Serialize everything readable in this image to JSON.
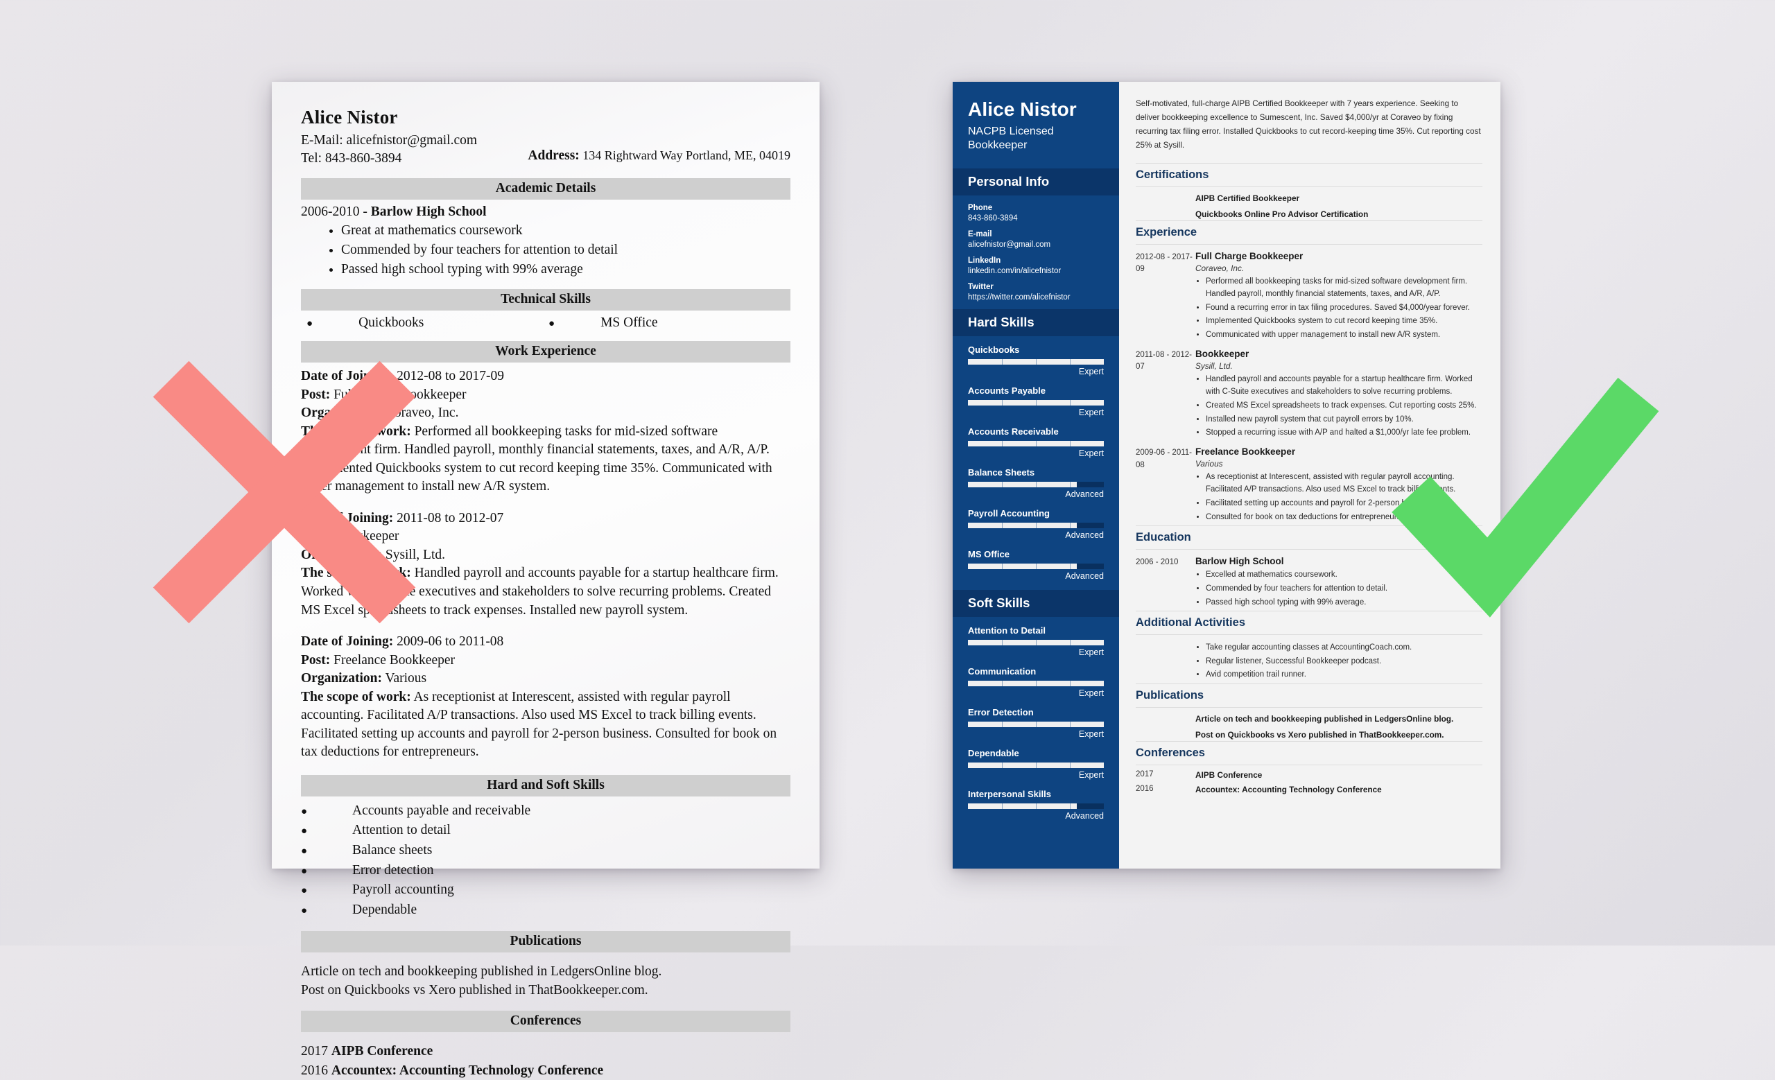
{
  "bad_resume": {
    "name": "Alice Nistor",
    "email_line": "E-Mail: alicefnistor@gmail.com",
    "tel_line": "Tel: 843-860-3894",
    "address_label": "Address:",
    "address_value": "134 Rightward Way Portland, ME, 04019",
    "sections": {
      "academic": {
        "heading": "Academic Details",
        "school_line_years": "2006-2010 - ",
        "school_line_name": "Barlow High School",
        "bullets": [
          "Great at mathematics coursework",
          "Commended by four teachers for attention to detail",
          "Passed high school typing with 99% average"
        ]
      },
      "technical": {
        "heading": "Technical Skills",
        "items": [
          "Quickbooks",
          "MS Office"
        ]
      },
      "work": {
        "heading": "Work Experience",
        "labels": {
          "date": "Date of Joining:",
          "post": "Post:",
          "org": "Organization:",
          "scope": "The scope of work:"
        },
        "jobs": [
          {
            "dates": "2012-08 to 2017-09",
            "post": "Full Charge Bookkeeper",
            "org": "Coraveo, Inc.",
            "scope": "Performed all bookkeeping tasks for mid-sized software development firm. Handled payroll, monthly financial statements, taxes, and A/R, A/P. Implemented Quickbooks system to cut record keeping time 35%. Communicated with upper management to install new A/R system."
          },
          {
            "dates": "2011-08 to 2012-07",
            "post": "Bookkeeper",
            "org": "Sysill, Ltd.",
            "scope": "Handled payroll and accounts payable for a startup healthcare firm. Worked with C-Suite executives and stakeholders to solve recurring problems. Created MS Excel spreadsheets to track expenses. Installed new payroll system."
          },
          {
            "dates": "2009-06 to 2011-08",
            "post": "Freelance Bookkeeper",
            "org": "Various",
            "scope": "As receptionist at Interescent, assisted with regular payroll accounting. Facilitated A/P transactions. Also used MS Excel to track billing events. Facilitated setting up accounts and payroll for 2-person business. Consulted for book on tax deductions for entrepreneurs."
          }
        ]
      },
      "skills": {
        "heading": "Hard and Soft Skills",
        "items": [
          "Accounts payable and receivable",
          "Attention to detail",
          "Balance sheets",
          "Error detection",
          "Payroll accounting",
          "Dependable"
        ]
      },
      "publications": {
        "heading": "Publications",
        "lines": [
          "Article on tech and bookkeeping published in LedgersOnline blog.",
          "Post on Quickbooks vs Xero published in ThatBookkeeper.com."
        ]
      },
      "conferences": {
        "heading": "Conferences",
        "items": [
          {
            "year": "2017 ",
            "name": "AIPB Conference"
          },
          {
            "year": "2016 ",
            "name": "Accountex: Accounting Technology Conference"
          }
        ]
      }
    }
  },
  "good_resume": {
    "sidebar": {
      "name": "Alice Nistor",
      "title": "NACPB Licensed Bookkeeper",
      "personal_info": {
        "heading": "Personal Info",
        "fields": [
          {
            "label": "Phone",
            "value": "843-860-3894"
          },
          {
            "label": "E-mail",
            "value": "alicefnistor@gmail.com"
          },
          {
            "label": "LinkedIn",
            "value": "linkedin.com/in/alicefnistor"
          },
          {
            "label": "Twitter",
            "value": "https://twitter.com/alicefnistor"
          }
        ]
      },
      "hard_skills": {
        "heading": "Hard Skills",
        "items": [
          {
            "name": "Quickbooks",
            "level": "Expert",
            "pct": 100
          },
          {
            "name": "Accounts Payable",
            "level": "Expert",
            "pct": 100
          },
          {
            "name": "Accounts Receivable",
            "level": "Expert",
            "pct": 100
          },
          {
            "name": "Balance Sheets",
            "level": "Advanced",
            "pct": 80
          },
          {
            "name": "Payroll Accounting",
            "level": "Advanced",
            "pct": 80
          },
          {
            "name": "MS Office",
            "level": "Advanced",
            "pct": 80
          }
        ]
      },
      "soft_skills": {
        "heading": "Soft Skills",
        "items": [
          {
            "name": "Attention to Detail",
            "level": "Expert",
            "pct": 100
          },
          {
            "name": "Communication",
            "level": "Expert",
            "pct": 100
          },
          {
            "name": "Error Detection",
            "level": "Expert",
            "pct": 100
          },
          {
            "name": "Dependable",
            "level": "Expert",
            "pct": 100
          },
          {
            "name": "Interpersonal Skills",
            "level": "Advanced",
            "pct": 80
          }
        ]
      }
    },
    "main": {
      "summary": "Self-motivated, full-charge AIPB Certified Bookkeeper with 7 years experience. Seeking to deliver bookkeeping excellence to Sumescent, Inc. Saved $4,000/yr at Coraveo by fixing recurring tax filing error. Installed Quickbooks to cut record-keeping time 35%. Cut reporting cost 25% at Sysill.",
      "certifications": {
        "heading": "Certifications",
        "items": [
          "AIPB Certified Bookkeeper",
          "Quickbooks Online Pro Advisor Certification"
        ]
      },
      "experience": {
        "heading": "Experience",
        "jobs": [
          {
            "dates": "2012-08 - 2017-09",
            "title": "Full Charge Bookkeeper",
            "org": "Coraveo, Inc.",
            "bullets": [
              "Performed all bookkeeping tasks for mid-sized software development firm. Handled payroll, monthly financial statements, taxes, and A/R, A/P.",
              "Found a recurring error in tax filing procedures. Saved $4,000/year forever.",
              "Implemented Quickbooks system to cut record keeping time 35%.",
              "Communicated with upper management to install new A/R system."
            ]
          },
          {
            "dates": "2011-08 - 2012-07",
            "title": "Bookkeeper",
            "org": "Sysill, Ltd.",
            "bullets": [
              "Handled payroll and accounts payable for a startup healthcare firm. Worked with C-Suite executives and stakeholders to solve recurring problems.",
              "Created MS Excel spreadsheets to track expenses. Cut reporting costs 25%.",
              "Installed new payroll system that cut payroll errors by 10%.",
              "Stopped a recurring issue with A/P and halted a $1,000/yr late fee problem."
            ]
          },
          {
            "dates": "2009-06 - 2011-08",
            "title": "Freelance Bookkeeper",
            "org": "Various",
            "bullets": [
              "As receptionist at Interescent, assisted with regular payroll accounting. Facilitated A/P transactions. Also used MS Excel to track billing events.",
              "Facilitated setting up accounts and payroll for 2-person business.",
              "Consulted for book on tax deductions for entrepreneurs."
            ]
          }
        ]
      },
      "education": {
        "heading": "Education",
        "items": [
          {
            "dates": "2006 - 2010",
            "title": "Barlow High School",
            "bullets": [
              "Excelled at mathematics coursework.",
              "Commended by four teachers for attention to detail.",
              "Passed high school typing with 99% average."
            ]
          }
        ]
      },
      "additional": {
        "heading": "Additional Activities",
        "bullets": [
          "Take regular accounting classes at AccountingCoach.com.",
          "Regular listener, Successful Bookkeeper podcast.",
          "Avid competition trail runner."
        ]
      },
      "publications": {
        "heading": "Publications",
        "items": [
          "Article on tech and bookkeeping published in LedgersOnline blog.",
          "Post on Quickbooks vs Xero published in ThatBookkeeper.com."
        ]
      },
      "conferences": {
        "heading": "Conferences",
        "items": [
          {
            "year": "2017",
            "name": "AIPB Conference"
          },
          {
            "year": "2016",
            "name": "Accountex: Accounting Technology Conference"
          }
        ]
      }
    }
  },
  "marks": {
    "reject_color": "#f98a85",
    "approve_color": "#5bd967"
  }
}
